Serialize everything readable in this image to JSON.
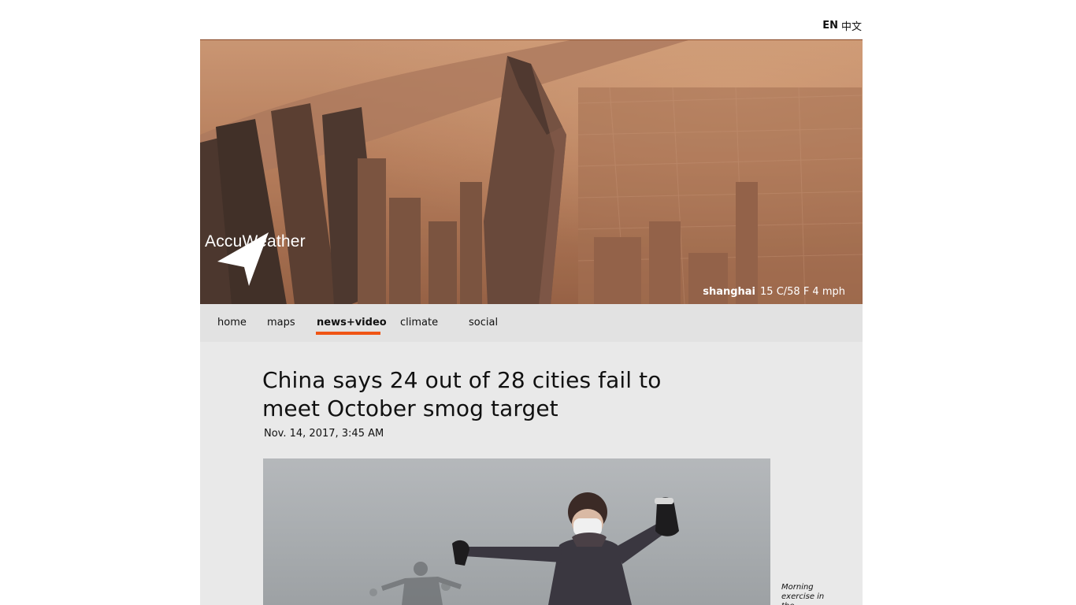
{
  "language": {
    "en_label": "EN",
    "zh_label": "中文"
  },
  "hero": {
    "image_alt": "Aerial view of Shanghai skyline in haze",
    "logo_text": "AccuWeather",
    "weather": {
      "city": "shanghai",
      "conditions": "15 C/58 F 4 mph"
    }
  },
  "nav": {
    "items": [
      {
        "label": "home"
      },
      {
        "label": "maps"
      },
      {
        "label": "news+video",
        "active": true
      },
      {
        "label": "climate"
      },
      {
        "label": "social"
      }
    ],
    "accent_color": "#f05514"
  },
  "article": {
    "headline": "China says 24 out of 28 cities fail to meet October smog target",
    "date": "Nov. 14, 2017, 3:45 AM",
    "photo_alt": "People exercising outdoors in heavy smog",
    "caption": "Morning exercise in the"
  }
}
